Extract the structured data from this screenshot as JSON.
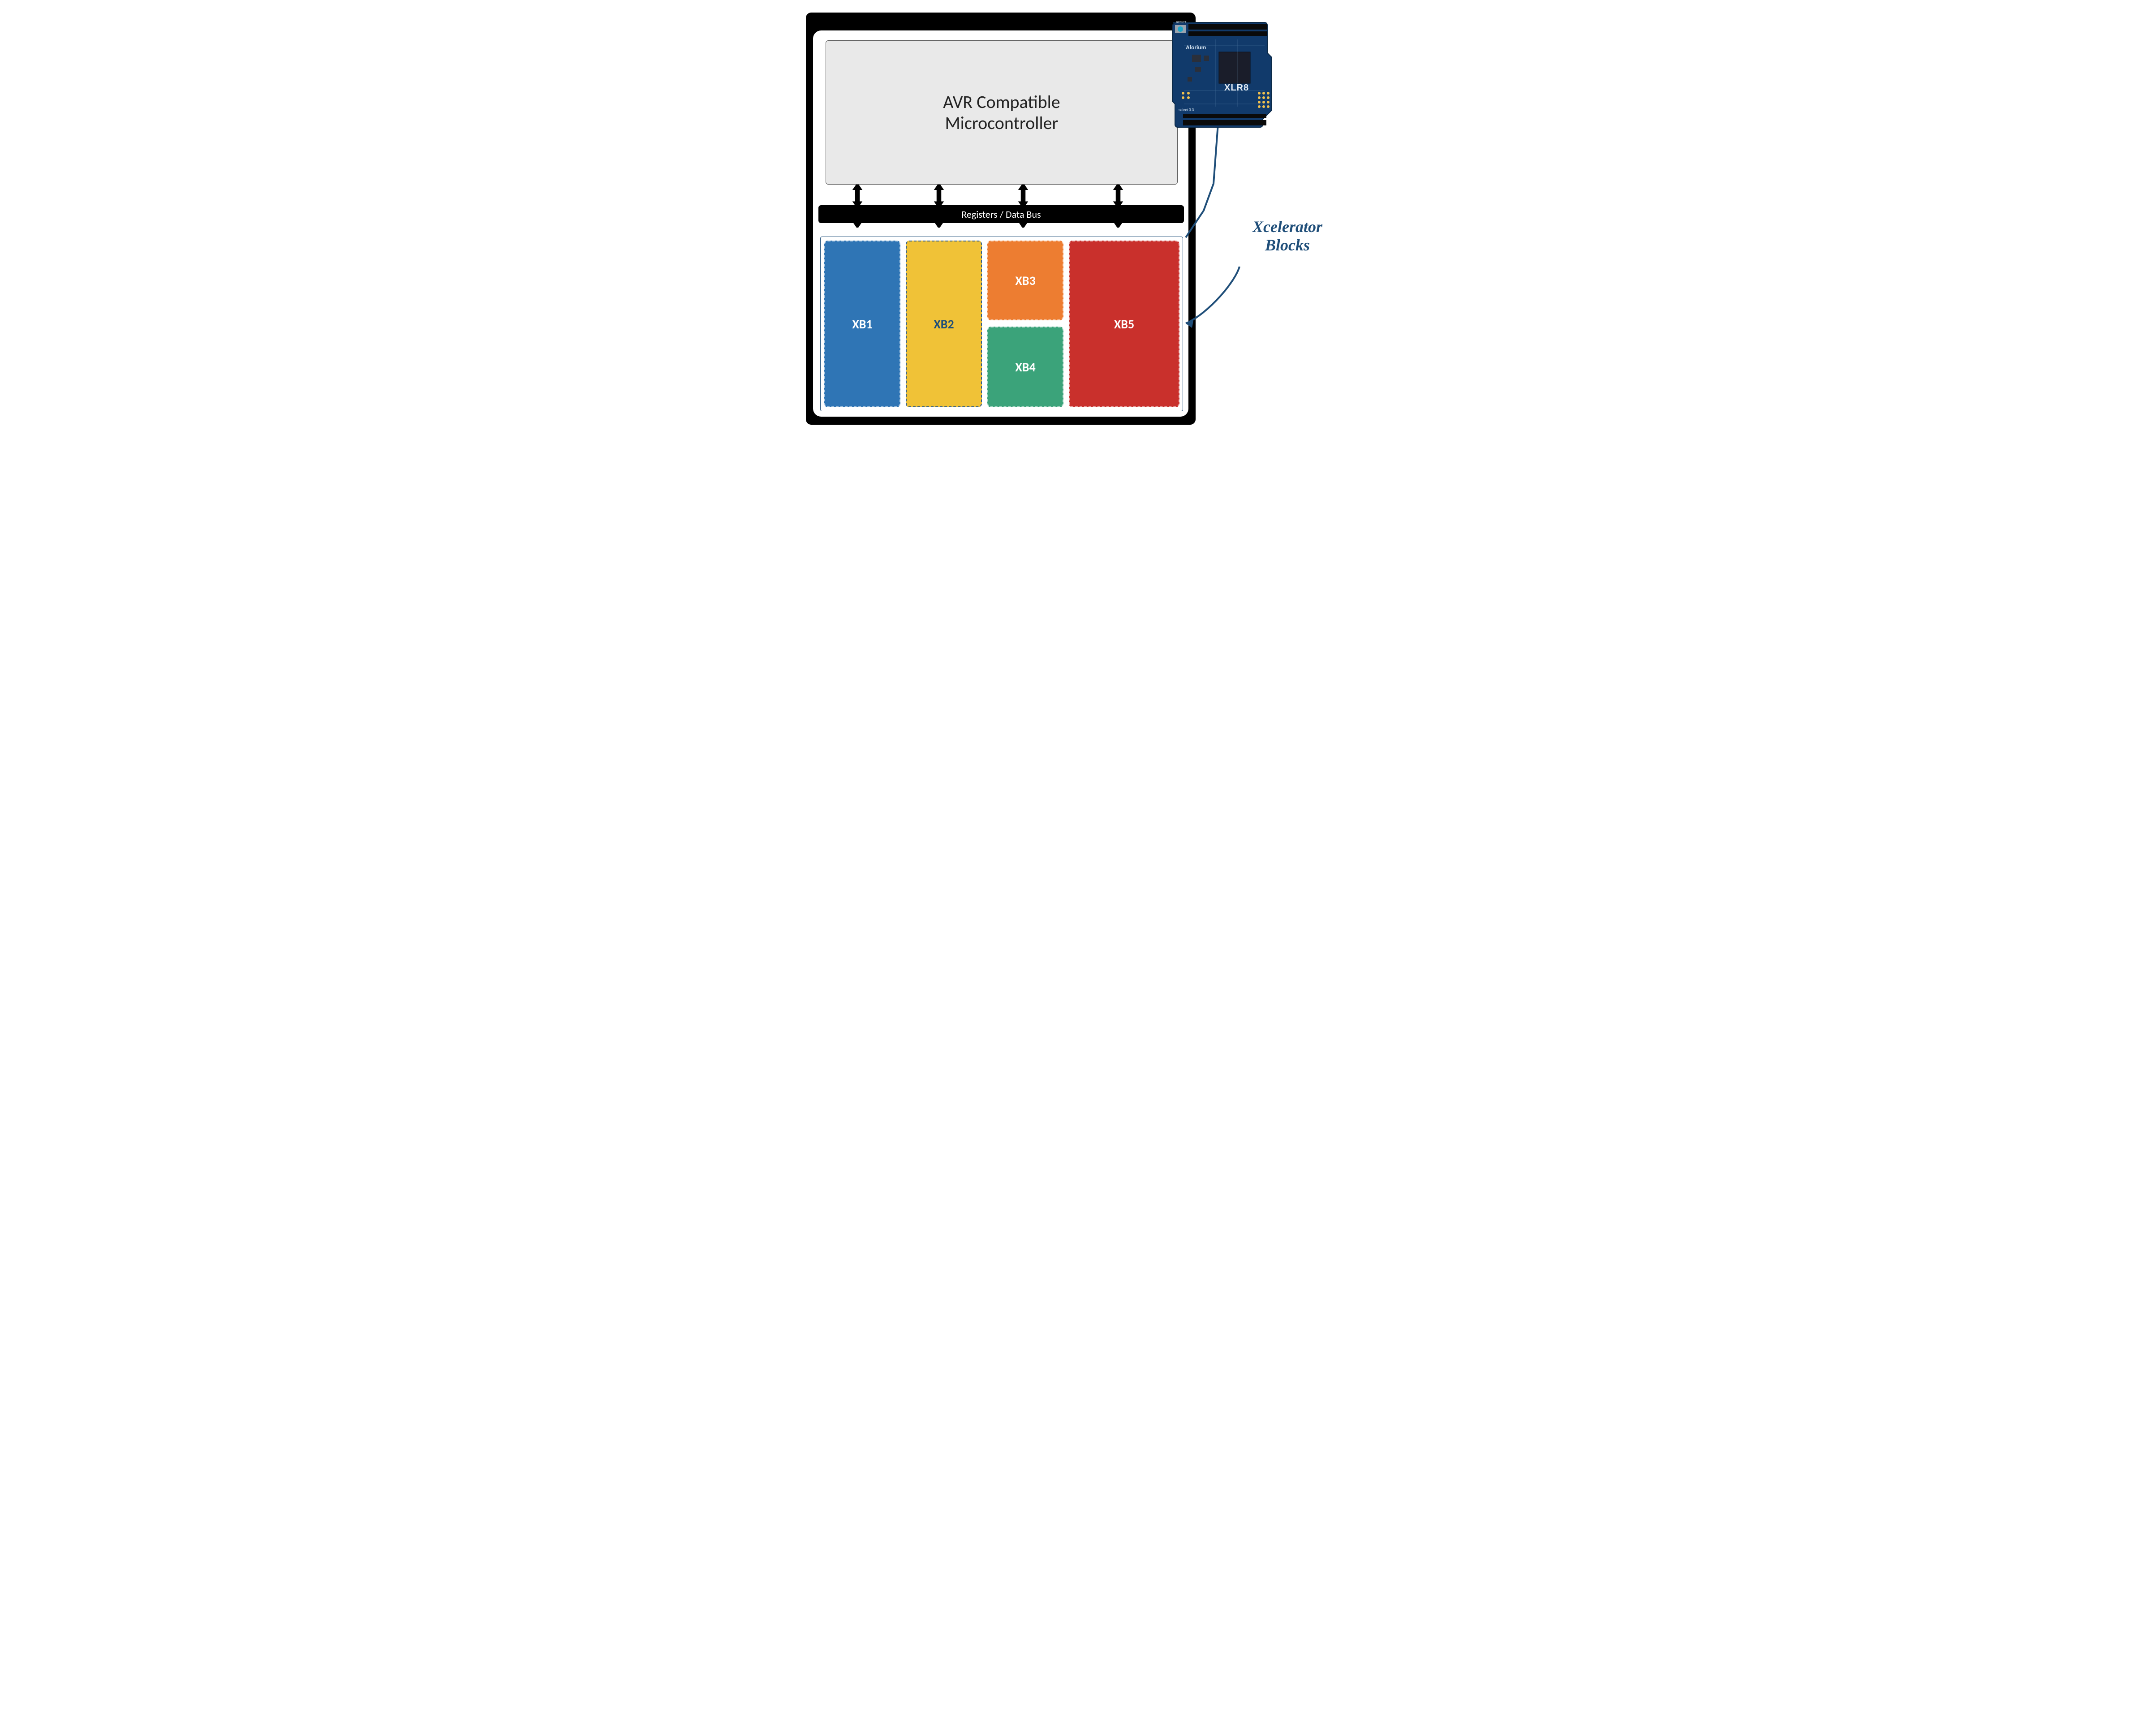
{
  "diagram": {
    "mcu_line1": "AVR Compatible",
    "mcu_line2": "Microcontroller",
    "bus_label": "Registers / Data Bus",
    "xcelerator_blocks": {
      "xb1": "XB1",
      "xb2": "XB2",
      "xb3": "XB3",
      "xb4": "XB4",
      "xb5": "XB5"
    },
    "callout": "Xcelerator Blocks",
    "board_brand_top": "Alorium",
    "board_brand_middle": "XLR8",
    "board_reset_label": "RESET",
    "board_select_label": "select 3.3"
  },
  "colors": {
    "frame": "#000000",
    "mcu_bg": "#e9e9e9",
    "xb1": "#2f75b5",
    "xb2": "#f0c237",
    "xb3": "#ed7d31",
    "xb4": "#3ba37a",
    "xb5": "#c9302c",
    "callout_text": "#1f4e79",
    "board_pcb": "#113a6b",
    "board_chip": "#1a1d2a",
    "board_silk": "#d8e6f3"
  }
}
